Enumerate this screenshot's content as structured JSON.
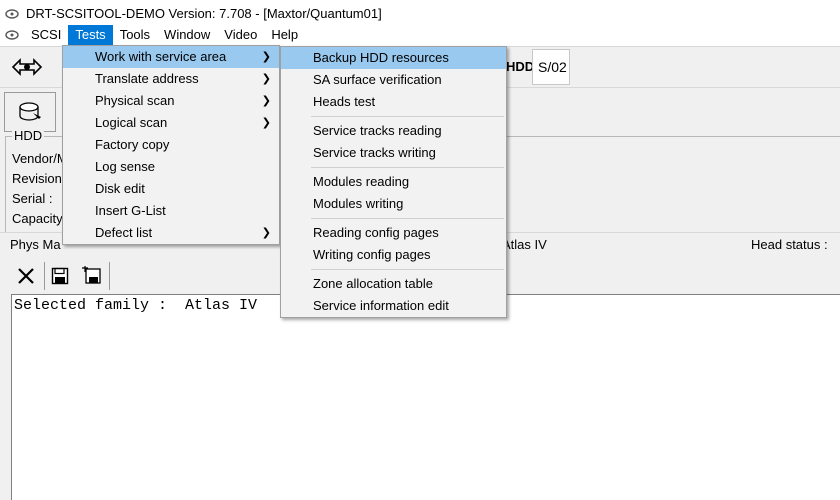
{
  "window": {
    "title": "DRT-SCSITOOL-DEMO Version: 7.708 - [Maxtor/Quantum01]"
  },
  "menubar": {
    "items": [
      "SCSI",
      "Tests",
      "Tools",
      "Window",
      "Video",
      "Help"
    ],
    "active": "Tests"
  },
  "toolbar": {
    "hdd_label": "HDD:",
    "hdd_value": "S/02"
  },
  "hdd_group": {
    "legend": "HDD",
    "vendor_label": "Vendor/M",
    "revision_label": "Revision",
    "serial_label": "Serial :",
    "capacity_label": "Capacity"
  },
  "status": {
    "phys_label": "Phys Ma",
    "family_value": "Atlas IV",
    "head_status_label": "Head status :"
  },
  "log": {
    "text": "Selected family :  Atlas IV"
  },
  "tests_menu": {
    "items": [
      {
        "label": "Work with service area",
        "submenu": true,
        "highlighted": true
      },
      {
        "label": "Translate address",
        "submenu": true
      },
      {
        "label": "Physical scan",
        "submenu": true
      },
      {
        "label": "Logical scan",
        "submenu": true
      },
      {
        "label": "Factory copy",
        "submenu": false
      },
      {
        "label": "Log sense",
        "submenu": false
      },
      {
        "label": "Disk edit",
        "submenu": false
      },
      {
        "label": "Insert G-List",
        "submenu": false
      },
      {
        "label": "Defect list",
        "submenu": true
      }
    ]
  },
  "service_menu": {
    "groups": [
      [
        "Backup HDD resources",
        "SA surface verification",
        "Heads test"
      ],
      [
        "Service tracks reading",
        "Service tracks writing"
      ],
      [
        "Modules reading",
        "Modules writing"
      ],
      [
        "Reading config pages",
        "Writing config pages"
      ],
      [
        "Zone allocation table",
        "Service information edit"
      ]
    ],
    "highlighted": "Backup HDD resources"
  },
  "colors": {
    "menu_active": "#0078d7",
    "menu_highlight": "#99c9ef"
  }
}
